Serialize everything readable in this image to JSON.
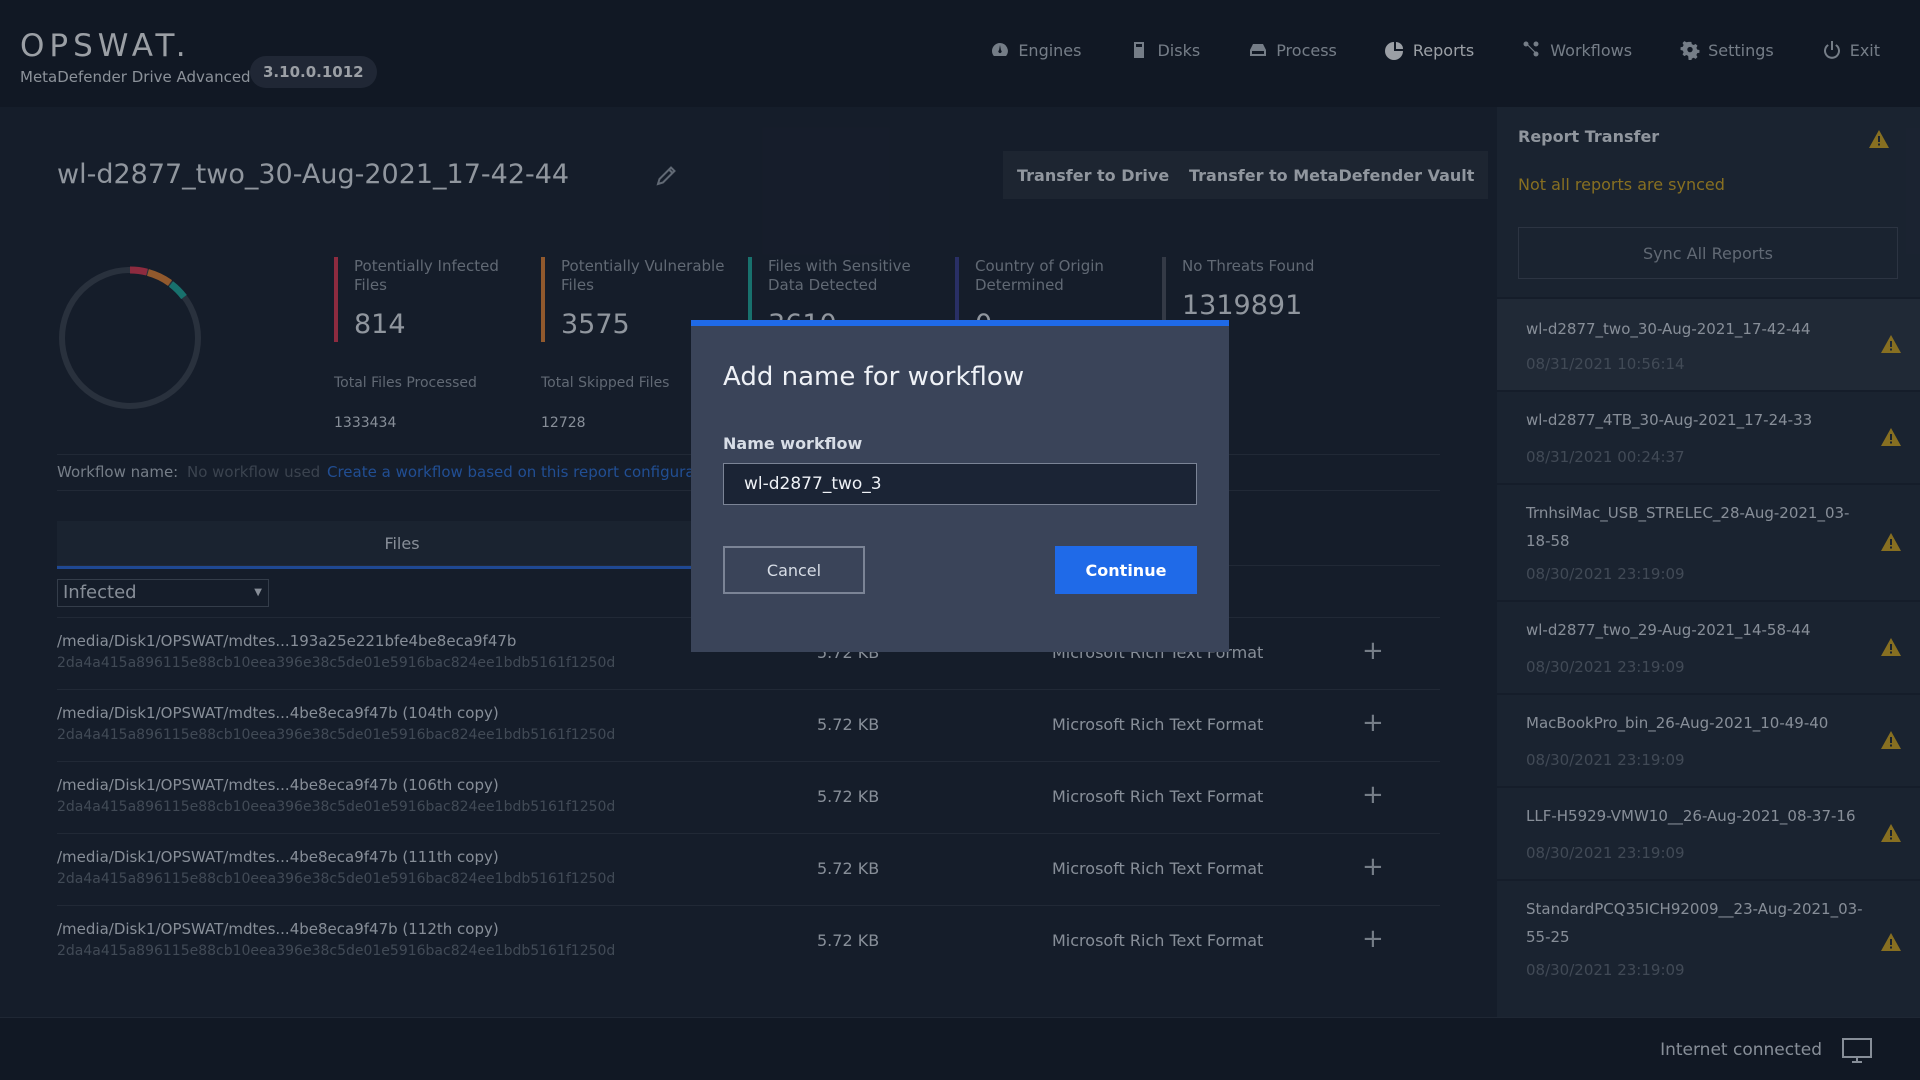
{
  "header": {
    "logo": "OPSWAT.",
    "product": "MetaDefender Drive Advanced",
    "version": "3.10.0.1012",
    "nav": [
      {
        "label": "Engines",
        "icon": "engines-icon"
      },
      {
        "label": "Disks",
        "icon": "disks-icon"
      },
      {
        "label": "Process",
        "icon": "process-icon"
      },
      {
        "label": "Reports",
        "icon": "reports-icon",
        "active": true
      },
      {
        "label": "Workflows",
        "icon": "workflows-icon"
      },
      {
        "label": "Settings",
        "icon": "gear-icon"
      },
      {
        "label": "Exit",
        "icon": "power-icon"
      }
    ]
  },
  "report": {
    "title": "wl-d2877_two_30-Aug-2021_17-42-44",
    "transfer_drive": "Transfer to Drive",
    "transfer_vault": "Transfer to MetaDefender Vault",
    "stats": [
      {
        "label": "Potentially Infected Files",
        "value": "814",
        "color": "#d33a55"
      },
      {
        "label": "Potentially Vulnerable Files",
        "value": "3575",
        "color": "#d9803a"
      },
      {
        "label": "Files with Sensitive Data Detected",
        "value": "3610",
        "color": "#1fa59c"
      },
      {
        "label": "Country of Origin Determined",
        "value": "0",
        "color": "#3a3f8f"
      },
      {
        "label": "No Threats Found",
        "value": "1319891",
        "color": "#4a5060"
      }
    ],
    "total_processed_label": "Total Files Processed",
    "total_processed": "1333434",
    "total_skipped_label": "Total Skipped Files",
    "total_skipped": "12728",
    "workflow_label": "Workflow name:",
    "workflow_none": "No workflow used",
    "workflow_link": "Create a workflow based on this report configuration",
    "tab_files": "Files",
    "filter": "Infected",
    "rows": [
      {
        "path": "/media/Disk1/OPSWAT/mdtes...193a25e221bfe4be8eca9f47b",
        "hash": "2da4a415a896115e88cb10eea396e38c5de01e5916bac824ee1bdb5161f1250d",
        "size": "5.72 KB",
        "type": "Microsoft Rich Text Format"
      },
      {
        "path": "/media/Disk1/OPSWAT/mdtes...4be8eca9f47b (104th copy)",
        "hash": "2da4a415a896115e88cb10eea396e38c5de01e5916bac824ee1bdb5161f1250d",
        "size": "5.72 KB",
        "type": "Microsoft Rich Text Format"
      },
      {
        "path": "/media/Disk1/OPSWAT/mdtes...4be8eca9f47b (106th copy)",
        "hash": "2da4a415a896115e88cb10eea396e38c5de01e5916bac824ee1bdb5161f1250d",
        "size": "5.72 KB",
        "type": "Microsoft Rich Text Format"
      },
      {
        "path": "/media/Disk1/OPSWAT/mdtes...4be8eca9f47b (111th copy)",
        "hash": "2da4a415a896115e88cb10eea396e38c5de01e5916bac824ee1bdb5161f1250d",
        "size": "5.72 KB",
        "type": "Microsoft Rich Text Format"
      },
      {
        "path": "/media/Disk1/OPSWAT/mdtes...4be8eca9f47b (112th copy)",
        "hash": "2da4a415a896115e88cb10eea396e38c5de01e5916bac824ee1bdb5161f1250d",
        "size": "5.72 KB",
        "type": "Microsoft Rich Text Format"
      }
    ]
  },
  "side": {
    "title": "Report Transfer",
    "message": "Not all reports are synced",
    "sync_button": "Sync All Reports",
    "items": [
      {
        "name": "wl-d2877_two_30-Aug-2021_17-42-44",
        "date": "08/31/2021 10:56:14"
      },
      {
        "name": "wl-d2877_4TB_30-Aug-2021_17-24-33",
        "date": "08/31/2021 00:24:37"
      },
      {
        "name": "TrnhsiMac_USB_STRELEC_28-Aug-2021_03-18-58",
        "date": "08/30/2021 23:19:09"
      },
      {
        "name": "wl-d2877_two_29-Aug-2021_14-58-44",
        "date": "08/30/2021 23:19:09"
      },
      {
        "name": "MacBookPro_bin_26-Aug-2021_10-49-40",
        "date": "08/30/2021 23:19:09"
      },
      {
        "name": "LLF-H5929-VMW10__26-Aug-2021_08-37-16",
        "date": "08/30/2021 23:19:09"
      },
      {
        "name": "StandardPCQ35ICH92009__23-Aug-2021_03-55-25",
        "date": "08/30/2021 23:19:09"
      }
    ]
  },
  "footer": {
    "status": "Internet connected"
  },
  "modal": {
    "title": "Add name for workflow",
    "label": "Name workflow",
    "value": "wl-d2877_two_3",
    "cancel": "Cancel",
    "continue": "Continue"
  }
}
